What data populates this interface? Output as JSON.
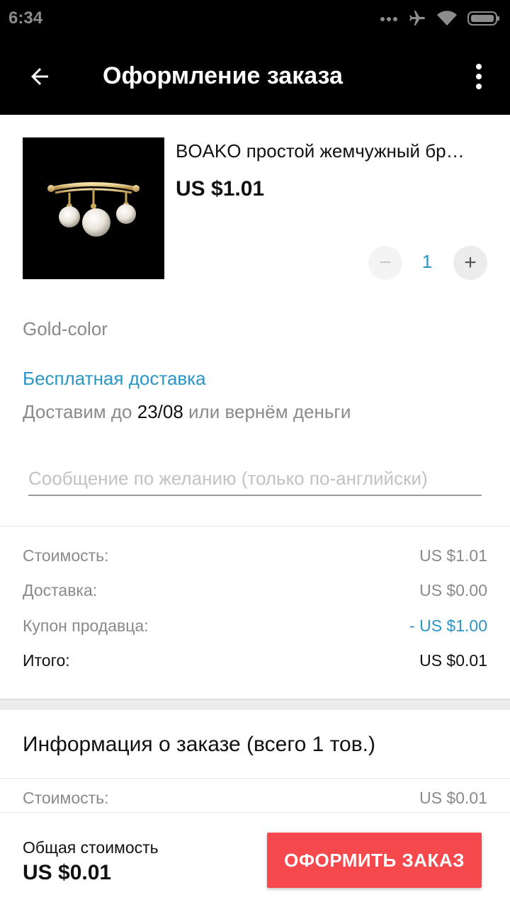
{
  "status_bar": {
    "time": "6:34"
  },
  "app_bar": {
    "title": "Оформление заказа"
  },
  "product": {
    "name": "BOAKO простой жемчужный бр…",
    "price": "US $1.01",
    "quantity": "1",
    "qty_minus": "−",
    "qty_plus": "+",
    "variant": "Gold-color"
  },
  "shipping": {
    "method": "Бесплатная доставка",
    "delivery_prefix": "Доставим до ",
    "delivery_date": "23/08",
    "delivery_suffix": " или вернём деньги"
  },
  "message": {
    "placeholder": "Сообщение по желанию (только по-английски)"
  },
  "summary": [
    {
      "label": "Стоимость:",
      "value": "US $1.01"
    },
    {
      "label": "Доставка:",
      "value": "US $0.00"
    },
    {
      "label": "Купон продавца:",
      "value": "- US $1.00"
    },
    {
      "label": "Итого:",
      "value": "US $0.01"
    }
  ],
  "order_info": {
    "title": "Информация о заказе (всего 1 тов.)",
    "rows": [
      {
        "label": "Стоимость:",
        "value": "US $0.01"
      }
    ]
  },
  "bottom_bar": {
    "total_label": "Общая стоимость",
    "total_amount": "US $0.01",
    "checkout_label": "ОФОРМИТЬ ЗАКАЗ"
  },
  "colors": {
    "accent_blue": "#2b95c6",
    "checkout_red": "#f5494d",
    "app_bar_bg": "#000000"
  },
  "icons": [
    "signal-dots-icon",
    "airplane-icon",
    "wifi-icon",
    "battery-icon",
    "back-arrow-icon",
    "more-vert-icon",
    "pearl-brooch-image"
  ]
}
